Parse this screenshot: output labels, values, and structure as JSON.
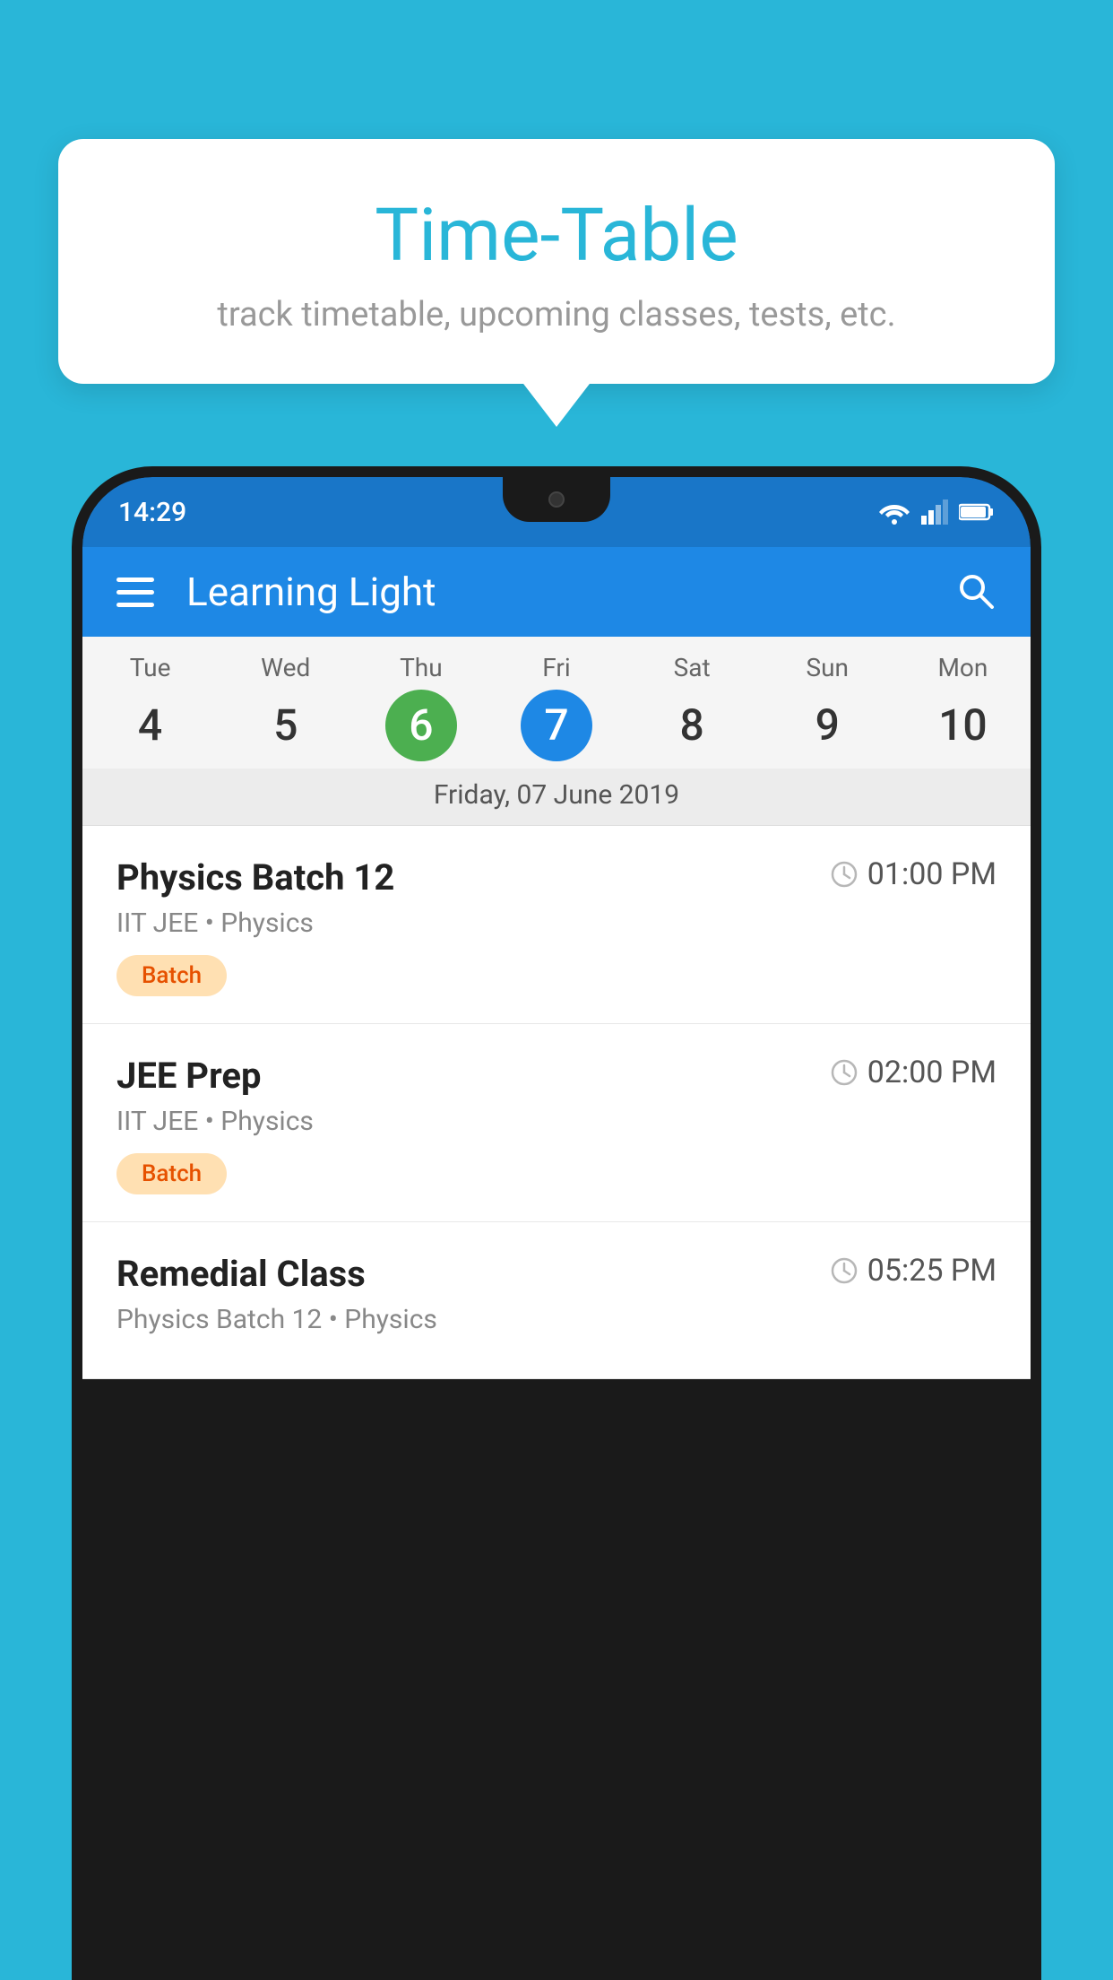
{
  "background_color": "#29b6d8",
  "tooltip": {
    "title": "Time-Table",
    "subtitle": "track timetable, upcoming classes, tests, etc."
  },
  "phone": {
    "status_bar": {
      "time": "14:29"
    },
    "app_bar": {
      "title": "Learning Light"
    },
    "calendar": {
      "days": [
        {
          "name": "Tue",
          "num": "4",
          "state": "normal"
        },
        {
          "name": "Wed",
          "num": "5",
          "state": "normal"
        },
        {
          "name": "Thu",
          "num": "6",
          "state": "today"
        },
        {
          "name": "Fri",
          "num": "7",
          "state": "selected"
        },
        {
          "name": "Sat",
          "num": "8",
          "state": "normal"
        },
        {
          "name": "Sun",
          "num": "9",
          "state": "normal"
        },
        {
          "name": "Mon",
          "num": "10",
          "state": "normal"
        }
      ],
      "selected_date_label": "Friday, 07 June 2019"
    },
    "classes": [
      {
        "name": "Physics Batch 12",
        "time": "01:00 PM",
        "detail": "IIT JEE • Physics",
        "badge": "Batch"
      },
      {
        "name": "JEE Prep",
        "time": "02:00 PM",
        "detail": "IIT JEE • Physics",
        "badge": "Batch"
      },
      {
        "name": "Remedial Class",
        "time": "05:25 PM",
        "detail": "Physics Batch 12 • Physics",
        "badge": null
      }
    ]
  }
}
